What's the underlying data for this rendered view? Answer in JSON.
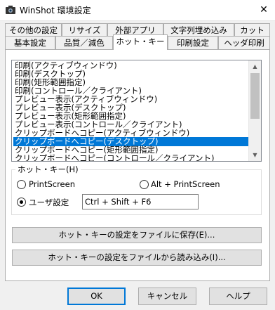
{
  "window": {
    "title": "WinShot 環境設定",
    "close_glyph": "✕"
  },
  "tabs_row1": [
    "その他の設定",
    "リサイズ",
    "外部アプリ",
    "文字列埋め込み",
    "カット"
  ],
  "tabs_row2": [
    "基本設定",
    "品質／減色",
    "ホット・キー",
    "印刷設定",
    "ヘッダ印刷"
  ],
  "active_tab": "ホット・キー",
  "actions_list": {
    "items": [
      "印刷(アクティブウィンドウ)",
      "印刷(デスクトップ)",
      "印刷(矩形範囲指定)",
      "印刷(コントロール／クライアント)",
      "プレビュー表示(アクティブウィンドウ)",
      "プレビュー表示(デスクトップ)",
      "プレビュー表示(矩形範囲指定)",
      "プレビュー表示(コントロール／クライアント)",
      "クリップボードへコピー(アクティブウィンドウ)",
      "クリップボードへコピー(デスクトップ)",
      "クリップボードへコピー(矩形範囲指定)",
      "クリップボードへコピー(コントロール／クライアント)"
    ],
    "selected_item": "クリップボードへコピー(デスクトップ)"
  },
  "hotkey_group": {
    "label": "ホット・キー(H)",
    "options": {
      "printscreen": "PrintScreen",
      "alt_printscreen": "Alt + PrintScreen",
      "user": "ユーザ設定"
    },
    "selected_option": "ユーザ設定",
    "user_value": "Ctrl + Shift + F6"
  },
  "buttons": {
    "save": "ホット・キーの設定をファイルに保存(E)...",
    "load": "ホット・キーの設定をファイルから読み込み(I)...",
    "ok": "OK",
    "cancel": "キャンセル",
    "help": "ヘルプ"
  },
  "colors": {
    "selection": "#0078d7",
    "default_button_border": "#0078d7",
    "dialog_bg": "#f0f0f0"
  },
  "icons": {
    "app": "camera-icon",
    "scroll_up": "chevron-up-icon",
    "scroll_down": "chevron-down-icon"
  }
}
